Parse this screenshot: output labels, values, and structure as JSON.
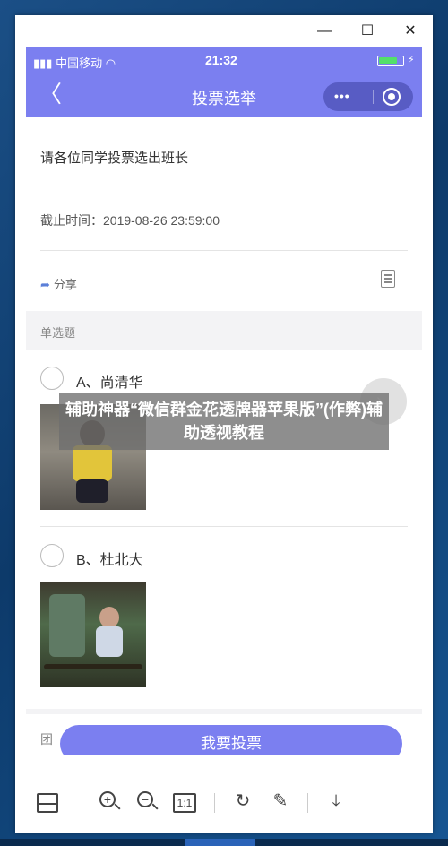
{
  "window": {
    "minimize_glyph": "—",
    "maximize_glyph": "☐",
    "close_glyph": "✕"
  },
  "statusbar": {
    "carrier": "中国移动",
    "time": "21:32",
    "battery_level": 0.8,
    "icons": [
      "signal-icon",
      "wifi-icon",
      "battery-icon",
      "charging-icon"
    ]
  },
  "navbar": {
    "back_glyph": "〈",
    "title": "投票选举",
    "more_glyph": "•••"
  },
  "vote": {
    "title": "请各位同学投票选出班长",
    "deadline": "截止时间：2019-08-26 23:59:00",
    "share_label": "分享",
    "section_label": "单选题"
  },
  "options": [
    {
      "label": "A、尚清华"
    },
    {
      "label": "B、杜北大"
    }
  ],
  "overlay": {
    "banner_text": "辅助神器“微信群金花透牌器苹果版”(作弊)辅助透视教程",
    "chevron_glyph": "›"
  },
  "bottom": {
    "stub_text": "团",
    "vote_button_label": "我要投票"
  },
  "toolbar": {
    "zoom_in_glyph": "+",
    "zoom_out_glyph": "−",
    "actual_size_label": "1:1",
    "rotate_glyph": "↻",
    "edit_glyph": "✎",
    "download_glyph": "⤓"
  },
  "colors": {
    "accent": "#7b7ff0",
    "battery": "#53e06a"
  }
}
